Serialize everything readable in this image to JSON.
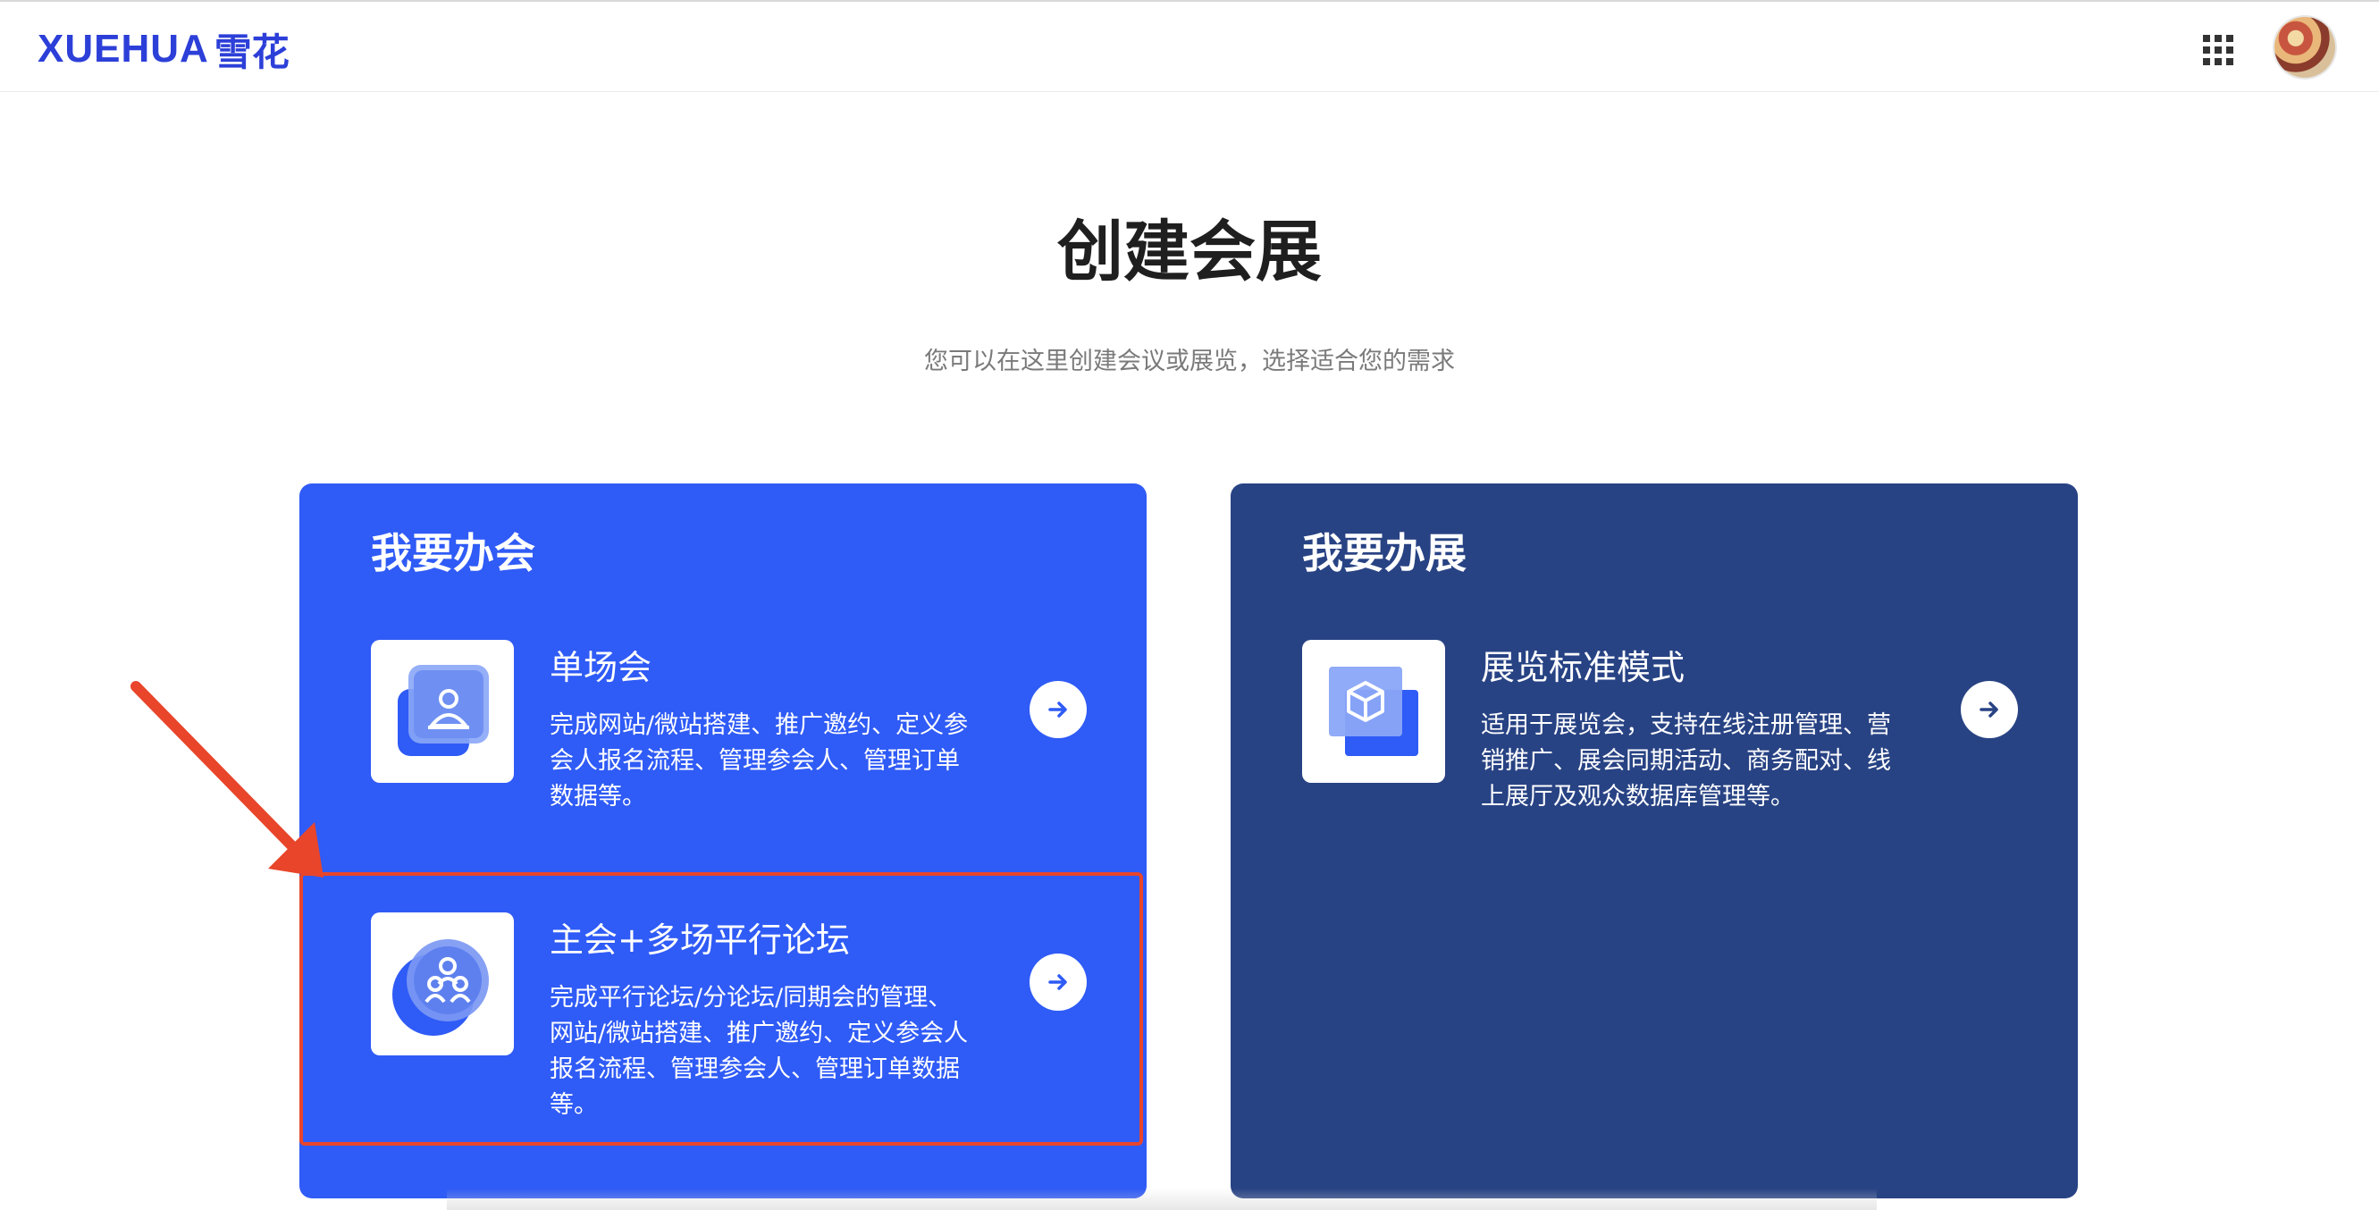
{
  "header": {
    "logo_latin": "XUEHUA",
    "logo_cn": "雪花",
    "apps_icon": "grid-apps-icon",
    "avatar_icon": "user-avatar"
  },
  "hero": {
    "title": "创建会展",
    "subtitle": "您可以在这里创建会议或展览，选择适合您的需求"
  },
  "cards": [
    {
      "title": "我要办会",
      "color": "#2f5bf6",
      "options": [
        {
          "title": "单场会",
          "desc_lines": [
            "完成网站/微站搭建、推广邀约、定义参",
            "会人报名流程、管理参会人、管理订单",
            "数据等。"
          ],
          "icon": "single-meeting-icon"
        },
        {
          "title": "主会+多场平行论坛",
          "desc_lines": [
            "完成平行论坛/分论坛/同期会的管理、",
            "网站/微站搭建、推广邀约、定义参会人",
            "报名流程、管理参会人、管理订单数据",
            "等。"
          ],
          "icon": "multi-forum-icon"
        }
      ]
    },
    {
      "title": "我要办展",
      "color": "#284384",
      "options": [
        {
          "title": "展览标准模式",
          "desc_lines": [
            "适用于展览会，支持在线注册管理、营",
            "销推广、展会同期活动、商务配对、线",
            "上展厅及观众数据库管理等。"
          ],
          "icon": "expo-box-icon"
        }
      ]
    }
  ],
  "annotation": {
    "color": "#e8452b"
  }
}
